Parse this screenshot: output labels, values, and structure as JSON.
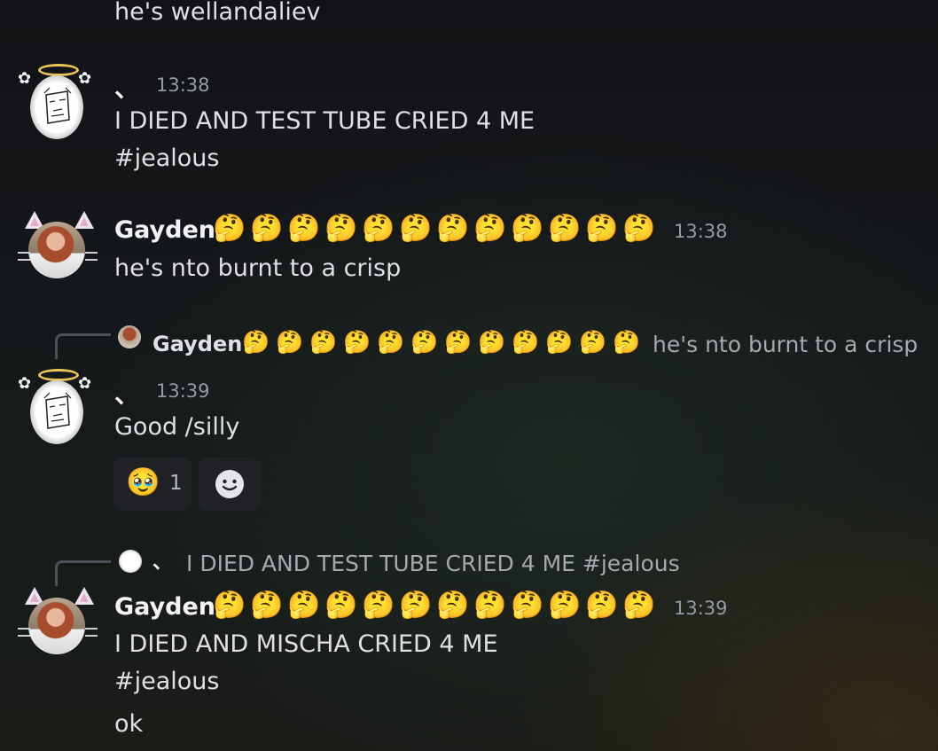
{
  "messages": [
    {
      "text_line": "he's wellandaliev"
    },
    {
      "author": "、",
      "time": "13:38",
      "lines": [
        "I DIED AND TEST TUBE CRIED 4 ME",
        "#jealous"
      ]
    },
    {
      "author": "Gayden",
      "author_emojis": [
        "🤔",
        "🤔",
        "🤔",
        "🤔",
        "🤔",
        "🤔",
        "🤔",
        "🤔",
        "🤔",
        "🤔",
        "🤔",
        "🤔"
      ],
      "time": "13:38",
      "lines": [
        "he's nto burnt to a crisp"
      ]
    },
    {
      "reply_to": {
        "author": "Gayden",
        "author_emojis": [
          "🤔",
          "🤔",
          "🤔",
          "🤔",
          "🤔",
          "🤔",
          "🤔",
          "🤔",
          "🤔",
          "🤔",
          "🤔",
          "🤔"
        ],
        "text": "he's nto burnt to a crisp"
      },
      "author": "、",
      "time": "13:39",
      "lines": [
        "Good /silly"
      ],
      "reactions": [
        {
          "emoji": "🥹",
          "count": "1"
        }
      ],
      "add_reaction_icon": "add-reaction-icon"
    },
    {
      "reply_to": {
        "author": "、",
        "text": "I DIED AND TEST TUBE CRIED 4 ME  #jealous"
      },
      "author": "Gayden",
      "author_emojis": [
        "🤔",
        "🤔",
        "🤔",
        "🤔",
        "🤔",
        "🤔",
        "🤔",
        "🤔",
        "🤔",
        "🤔",
        "🤔",
        "🤔"
      ],
      "time": "13:39",
      "lines": [
        "I DIED AND MISCHA CRIED 4 ME",
        "#jealous",
        "ok"
      ]
    }
  ],
  "colors": {
    "username": "#f2f3f5",
    "timestamp": "#949ba4",
    "text": "#dfe0e3",
    "reply_text": "#a6a9b0"
  }
}
